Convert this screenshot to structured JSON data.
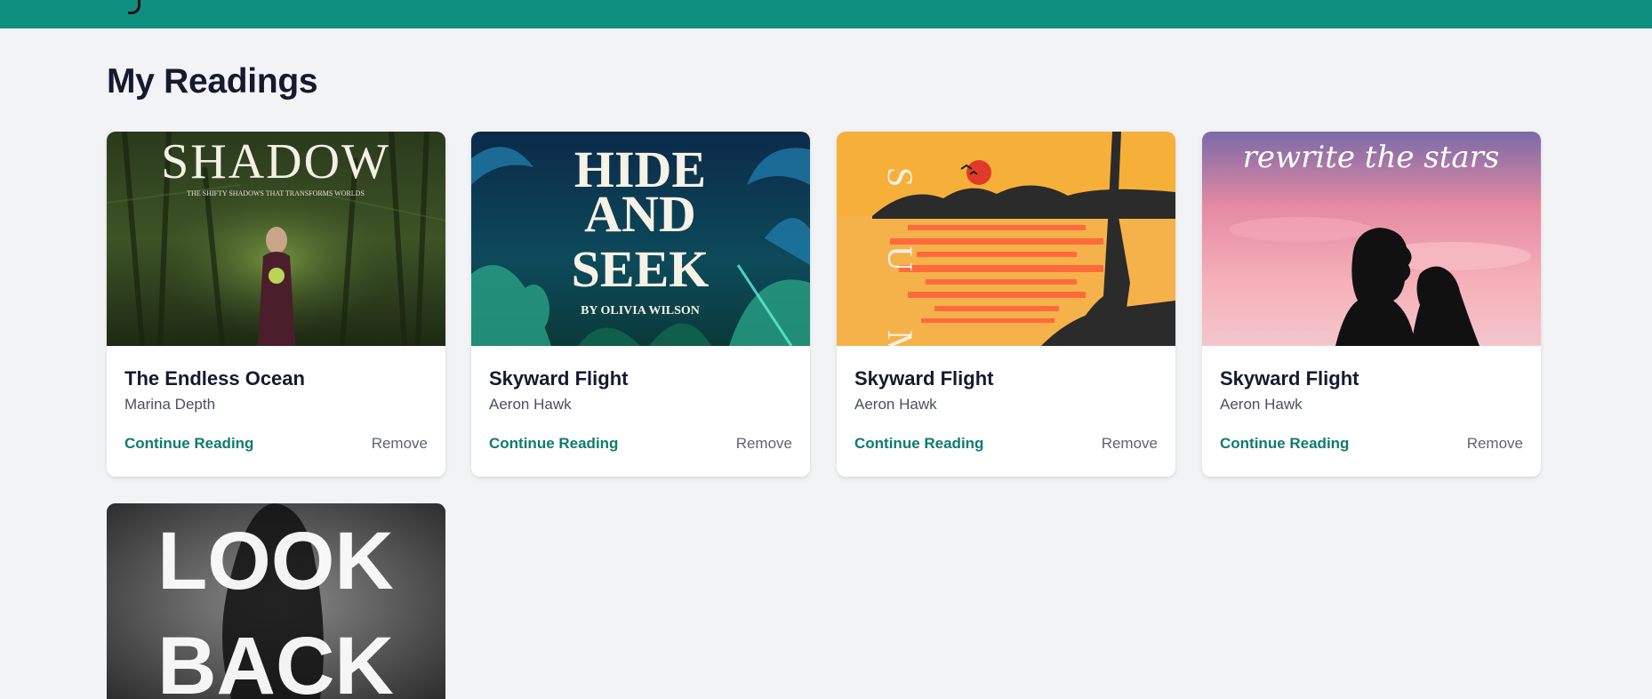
{
  "page": {
    "title": "My Readings"
  },
  "actions": {
    "continue_label": "Continue Reading",
    "remove_label": "Remove"
  },
  "books": [
    {
      "title": "The Endless Ocean",
      "author": "Marina Depth",
      "cover": {
        "headline": "SHADOW",
        "tagline": "THE SHIFTY SHADOWS THAT TRANSFORMS WORLDS"
      }
    },
    {
      "title": "Skyward Flight",
      "author": "Aeron Hawk",
      "cover": {
        "line1": "HIDE",
        "line2": "AND",
        "line3": "SEEK",
        "byline": "BY OLIVIA WILSON"
      }
    },
    {
      "title": "Skyward Flight",
      "author": "Aeron Hawk",
      "cover": {
        "letters": "S U M"
      }
    },
    {
      "title": "Skyward Flight",
      "author": "Aeron Hawk",
      "cover": {
        "script": "rewrite the stars"
      }
    }
  ],
  "partial_book": {
    "cover": {
      "line1": "LOOK",
      "line2": "BACK"
    }
  },
  "colors": {
    "brand": "#0e8f80",
    "accent_text": "#0f7a70",
    "background": "#f2f3f5"
  }
}
